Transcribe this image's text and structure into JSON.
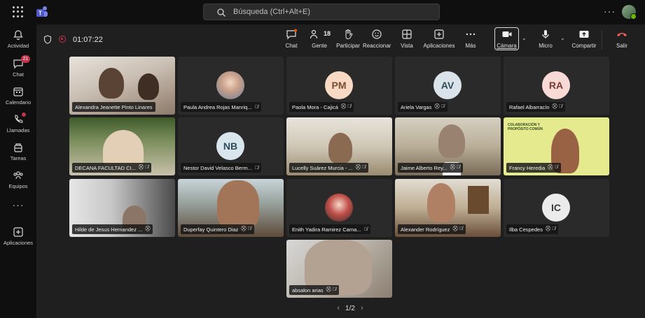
{
  "search": {
    "placeholder": "Búsqueda (Ctrl+Alt+E)"
  },
  "rail": {
    "items": [
      {
        "label": "Actividad",
        "icon": "bell-icon"
      },
      {
        "label": "Chat",
        "icon": "chat-icon",
        "badge": "21"
      },
      {
        "label": "Calendario",
        "icon": "calendar-icon"
      },
      {
        "label": "Llamadas",
        "icon": "phone-icon"
      },
      {
        "label": "Tareas",
        "icon": "tasks-icon"
      },
      {
        "label": "Equipos",
        "icon": "teams-icon"
      },
      {
        "label": "Aplicaciones",
        "icon": "add-apps-icon"
      }
    ]
  },
  "meeting": {
    "elapsed": "01:07:22",
    "toolbar": {
      "chat": "Chat",
      "people": "Gente",
      "people_count": "18",
      "raise": "Participar",
      "react": "Reaccionar",
      "view": "Vista",
      "apps": "Aplicaciones",
      "more": "Más",
      "camera": "Cámara",
      "mic": "Micro",
      "share": "Compartir",
      "leave": "Salir"
    },
    "participants": [
      {
        "name": "Alexandra Jeanette Pinto Linares",
        "type": "video"
      },
      {
        "name": "Paula Andrea Rojas Manriq...",
        "type": "photo"
      },
      {
        "name": "Paola Mora - Cajicá",
        "type": "initials",
        "initials": "PM",
        "color": "#f7d9c4"
      },
      {
        "name": "Ariela Vargas",
        "type": "initials",
        "initials": "AV",
        "color": "#d9e3e9"
      },
      {
        "name": "Rafael Albarracín",
        "type": "initials",
        "initials": "RA",
        "color": "#f7d9d6"
      },
      {
        "name": "DECANA FACULTAD CI...",
        "type": "video"
      },
      {
        "name": "Nestor David Velasco Berm...",
        "type": "initials",
        "initials": "NB",
        "color": "#d9e6ee"
      },
      {
        "name": "Lucelly Suárez Murcia - ...",
        "type": "video"
      },
      {
        "name": "Jaime Alberto Rey...",
        "type": "video"
      },
      {
        "name": "Francy Heredia",
        "type": "video"
      },
      {
        "name": "Hilde de Jesus Hernandez ...",
        "type": "video"
      },
      {
        "name": "Duperfay Quintero Diaz",
        "type": "video"
      },
      {
        "name": "Enith Yadira Ramirez Cama...",
        "type": "photo"
      },
      {
        "name": "Alexander Rodríguez",
        "type": "video"
      },
      {
        "name": "Ilba Cespedes",
        "type": "initials",
        "initials": "IC",
        "color": "#ecebeb"
      },
      {
        "name": "absalon arias",
        "type": "video"
      }
    ],
    "francy_banner": "COLABORACIÓN Y PROPÓSITO COMÚN",
    "pager": "1/2"
  }
}
